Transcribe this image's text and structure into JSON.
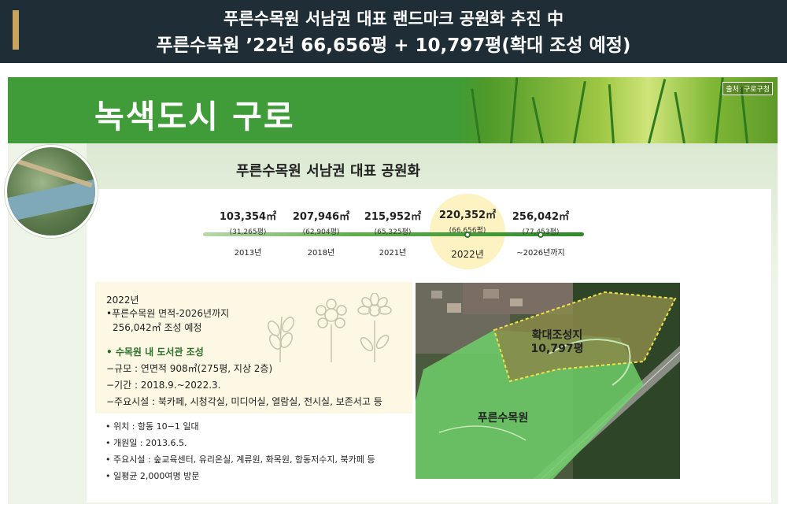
{
  "banner": {
    "line1": "푸른수목원 서남권 대표 랜드마크 공원화 추진 中",
    "line2": "푸른수목원 ’22년 66,656평 + 10,797평(확대 조성 예정)"
  },
  "header": {
    "title": "녹색도시 구로",
    "source": "출처: 구로구청"
  },
  "section_title": "푸른수목원 서남권 대표 공원화",
  "timeline": [
    {
      "area": "103,354㎡",
      "pyeong": "(31,265평)",
      "year": "2013년"
    },
    {
      "area": "207,946㎡",
      "pyeong": "(62,904평)",
      "year": "2018년"
    },
    {
      "area": "215,952㎡",
      "pyeong": "(65,325평)",
      "year": "2021년"
    },
    {
      "area": "220,352㎡",
      "pyeong": "(66,656평)",
      "year": "2022년"
    },
    {
      "area": "256,042㎡",
      "pyeong": "(77,453평)",
      "year": "~2026년까지"
    }
  ],
  "info": {
    "year": "2022년",
    "line1": "•푸른수목원 면적-2026년까지",
    "line2": "256,042㎡ 조성 예정",
    "library_title": "• 수목원 내 도서관 조성",
    "scale": "−규모 : 연면적 908㎡(275평, 지상 2층)",
    "period": "−기간 : 2018.9.~2022.3.",
    "facilities": "−주요시설 : 북카페, 시청각실, 미디어실, 열람실, 전시실, 보존서고 등"
  },
  "facts": {
    "location": "• 위치 : 항동 10−1 일대",
    "opened": "• 개원일 : 2013.6.5.",
    "facilities": "• 주요시설 : 숲교육센터, 유리온실, 계류원, 화목원, 항동저수지, 북카페 등",
    "visitors": "• 일평균 2,000여명 방문"
  },
  "map": {
    "expansion_label": "확대조성지",
    "expansion_area": "10,797평",
    "park_label": "푸른수목원"
  }
}
